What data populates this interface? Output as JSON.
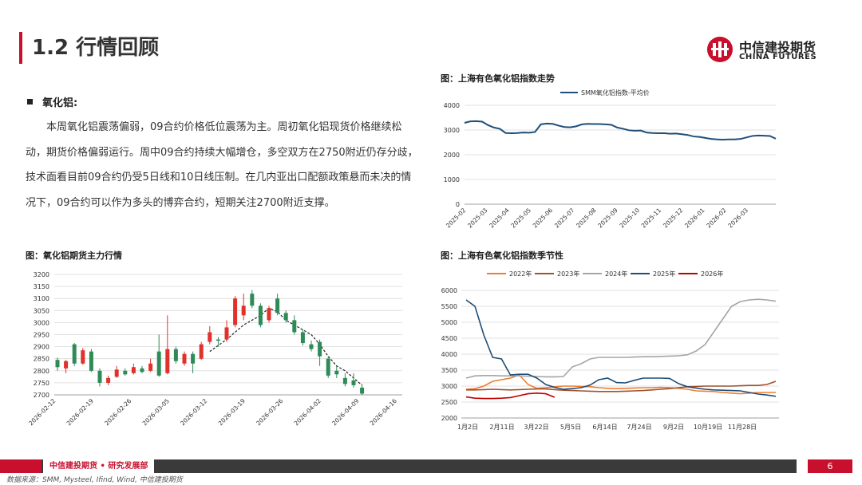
{
  "page": {
    "title": "1.2 行情回顾",
    "page_number": "6"
  },
  "logo": {
    "name_cn": "中信建投期货",
    "name_en": "CHINA FUTURES"
  },
  "section": {
    "heading": "氧化铝:",
    "paragraph": "本周氧化铝震荡偏弱，09合约价格低位震荡为主。周初氧化铝现货价格继续松动，期货价格偏弱运行。周中09合约持续大幅增仓，多空双方在2750附近仍存分歧，技术面看目前09合约仍受5日线和10日线压制。在几内亚出口配额政策悬而未决的情况下，09合约可以作为多头的博弈合约，短期关注2700附近支撑。"
  },
  "footer": {
    "org": "中信建投期货 • 研究发展部",
    "source": "数据来源：SMM, Mysteel, Ifind, Wind, 中信建投期货"
  },
  "colors": {
    "accent": "#c8102e",
    "index_line": "#1f4e79",
    "candle_up": "#e0312b",
    "candle_down": "#2e8b57",
    "y2022": "#ed7d31",
    "y2023": "#a0522d",
    "y2024": "#a5a5a5",
    "y2025": "#1f4e79",
    "y2026": "#c00000"
  },
  "chart_data": [
    {
      "type": "line",
      "title": "图：上海有色氧化铝指数走势",
      "series": [
        {
          "name": "SMM氧化铝指数-平均价",
          "values": [
            3290,
            3350,
            3360,
            3340,
            3200,
            3100,
            3050,
            2880,
            2870,
            2880,
            2900,
            2890,
            2920,
            3230,
            3260,
            3250,
            3180,
            3120,
            3110,
            3150,
            3230,
            3250,
            3240,
            3240,
            3230,
            3210,
            3100,
            3050,
            2990,
            2970,
            2980,
            2900,
            2880,
            2870,
            2870,
            2850,
            2860,
            2830,
            2800,
            2740,
            2720,
            2680,
            2640,
            2620,
            2610,
            2620,
            2620,
            2640,
            2700,
            2760,
            2780,
            2770,
            2760,
            2650
          ]
        }
      ],
      "x_ticks": [
        "2025-02",
        "2025-03",
        "2025-04",
        "2025-05",
        "2025-06",
        "2025-07",
        "2025-08",
        "2025-09",
        "2025-10",
        "2025-11",
        "2025-12",
        "2026-01",
        "2026-02",
        "2026-03"
      ],
      "y_ticks": [
        "0",
        "1000",
        "2000",
        "3000",
        "4000"
      ],
      "ylim": [
        0,
        4000
      ],
      "legend": "top"
    },
    {
      "type": "candlestick",
      "title": "图：氧化铝期货主力行情",
      "candles": [
        {
          "o": 2845,
          "c": 2815,
          "h": 2855,
          "l": 2800
        },
        {
          "o": 2810,
          "c": 2840,
          "h": 2845,
          "l": 2790
        },
        {
          "o": 2910,
          "c": 2830,
          "h": 2915,
          "l": 2820
        },
        {
          "o": 2830,
          "c": 2885,
          "h": 2895,
          "l": 2825
        },
        {
          "o": 2880,
          "c": 2800,
          "h": 2890,
          "l": 2795
        },
        {
          "o": 2800,
          "c": 2750,
          "h": 2810,
          "l": 2735
        },
        {
          "o": 2750,
          "c": 2770,
          "h": 2780,
          "l": 2740
        },
        {
          "o": 2775,
          "c": 2805,
          "h": 2820,
          "l": 2770
        },
        {
          "o": 2800,
          "c": 2785,
          "h": 2810,
          "l": 2780
        },
        {
          "o": 2790,
          "c": 2815,
          "h": 2830,
          "l": 2785
        },
        {
          "o": 2810,
          "c": 2795,
          "h": 2820,
          "l": 2790
        },
        {
          "o": 2800,
          "c": 2830,
          "h": 2850,
          "l": 2795
        },
        {
          "o": 2880,
          "c": 2780,
          "h": 2950,
          "l": 2775
        },
        {
          "o": 2790,
          "c": 2890,
          "h": 3030,
          "l": 2785
        },
        {
          "o": 2890,
          "c": 2840,
          "h": 2900,
          "l": 2830
        },
        {
          "o": 2830,
          "c": 2870,
          "h": 2880,
          "l": 2820
        },
        {
          "o": 2870,
          "c": 2830,
          "h": 2880,
          "l": 2790
        },
        {
          "o": 2850,
          "c": 2910,
          "h": 2920,
          "l": 2845
        },
        {
          "o": 2920,
          "c": 2960,
          "h": 2985,
          "l": 2910
        },
        {
          "o": 2930,
          "c": 2925,
          "h": 2940,
          "l": 2900
        },
        {
          "o": 2930,
          "c": 2980,
          "h": 3010,
          "l": 2920
        },
        {
          "o": 2990,
          "c": 3100,
          "h": 3110,
          "l": 2980
        },
        {
          "o": 3030,
          "c": 3070,
          "h": 3120,
          "l": 3010
        },
        {
          "o": 3120,
          "c": 3070,
          "h": 3135,
          "l": 3060
        },
        {
          "o": 3070,
          "c": 2990,
          "h": 3080,
          "l": 2980
        },
        {
          "o": 3010,
          "c": 3060,
          "h": 3070,
          "l": 3000
        },
        {
          "o": 3100,
          "c": 3040,
          "h": 3120,
          "l": 3030
        },
        {
          "o": 3040,
          "c": 3010,
          "h": 3050,
          "l": 3000
        },
        {
          "o": 3010,
          "c": 2960,
          "h": 3030,
          "l": 2950
        },
        {
          "o": 2960,
          "c": 2915,
          "h": 2970,
          "l": 2905
        },
        {
          "o": 2910,
          "c": 2890,
          "h": 2925,
          "l": 2880
        },
        {
          "o": 2920,
          "c": 2860,
          "h": 2930,
          "l": 2820
        },
        {
          "o": 2850,
          "c": 2780,
          "h": 2860,
          "l": 2770
        },
        {
          "o": 2800,
          "c": 2785,
          "h": 2820,
          "l": 2770
        },
        {
          "o": 2770,
          "c": 2745,
          "h": 2790,
          "l": 2735
        },
        {
          "o": 2760,
          "c": 2740,
          "h": 2790,
          "l": 2730
        },
        {
          "o": 2730,
          "c": 2705,
          "h": 2745,
          "l": 2700
        }
      ],
      "ma_line": [
        null,
        null,
        null,
        null,
        null,
        null,
        null,
        null,
        null,
        null,
        null,
        null,
        null,
        null,
        null,
        null,
        null,
        null,
        2880,
        2905,
        2930,
        2960,
        2990,
        3010,
        3030,
        3060,
        3045,
        3010,
        2990,
        2970,
        2950,
        2910,
        2860,
        2820,
        2800,
        2770,
        2740
      ],
      "x_ticks": [
        "2026-02-12",
        "2026-02-19",
        "2026-02-26",
        "2026-03-05",
        "2026-03-12",
        "2026-03-19",
        "2026-03-26",
        "2026-04-02",
        "2026-04-09",
        "2026-04-16"
      ],
      "y_ticks": [
        "2700",
        "2750",
        "2800",
        "2850",
        "2900",
        "2950",
        "3000",
        "3050",
        "3100",
        "3150",
        "3200"
      ],
      "ylim": [
        2700,
        3200
      ]
    },
    {
      "type": "line",
      "title": "图：上海有色氧化铝指数季节性",
      "x_ticks": [
        "1月2日",
        "2月11日",
        "3月22日",
        "5月5日",
        "6月14日",
        "7月24日",
        "9月2日",
        "10月19日",
        "11月28日"
      ],
      "y_ticks": [
        "2000",
        "2500",
        "3000",
        "3500",
        "4000",
        "4500",
        "5000",
        "5500",
        "6000"
      ],
      "ylim": [
        2000,
        6000
      ],
      "legend": "top",
      "series": [
        {
          "name": "2022年",
          "values": [
            2900,
            2920,
            3000,
            3150,
            3200,
            3250,
            3350,
            3050,
            2930,
            2950,
            2980,
            3000,
            3000,
            2990,
            2980,
            2950,
            2930,
            2920,
            2930,
            2940,
            2950,
            2950,
            2960,
            2950,
            2930,
            2900,
            2850,
            2840,
            2830,
            2800,
            2780,
            2760,
            2780,
            2800,
            2800,
            2800
          ]
        },
        {
          "name": "2023年",
          "values": [
            2880,
            2880,
            2890,
            2900,
            2890,
            2880,
            2890,
            2900,
            2910,
            2910,
            2890,
            2870,
            2860,
            2850,
            2840,
            2830,
            2830,
            2830,
            2840,
            2850,
            2860,
            2880,
            2900,
            2920,
            2950,
            2980,
            2990,
            3000,
            3000,
            3000,
            3000,
            3010,
            3020,
            3020,
            3050,
            3150
          ]
        },
        {
          "name": "2024年",
          "values": [
            3250,
            3320,
            3330,
            3330,
            3320,
            3320,
            3320,
            3310,
            3300,
            3290,
            3290,
            3300,
            3600,
            3700,
            3850,
            3900,
            3900,
            3900,
            3900,
            3910,
            3920,
            3920,
            3930,
            3940,
            3950,
            3980,
            4100,
            4300,
            4700,
            5100,
            5500,
            5650,
            5700,
            5720,
            5700,
            5660
          ]
        },
        {
          "name": "2025年",
          "values": [
            5700,
            5500,
            4600,
            3900,
            3850,
            3350,
            3370,
            3370,
            3250,
            3050,
            2960,
            2900,
            2920,
            2950,
            3030,
            3200,
            3250,
            3110,
            3100,
            3180,
            3250,
            3250,
            3250,
            3240,
            3080,
            2980,
            2940,
            2900,
            2880,
            2870,
            2860,
            2850,
            2800,
            2750,
            2720,
            2680
          ]
        },
        {
          "name": "2026年",
          "values": [
            2660,
            2620,
            2610,
            2610,
            2620,
            2640,
            2700,
            2760,
            2780,
            2760,
            2650
          ]
        }
      ]
    }
  ]
}
